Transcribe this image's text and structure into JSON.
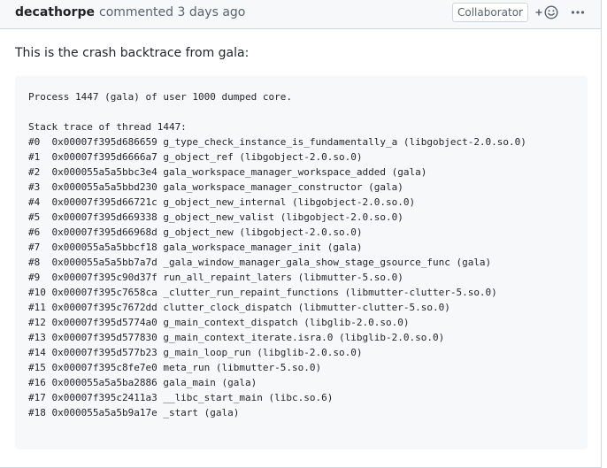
{
  "comment": {
    "author": "decathorpe",
    "action": "commented 3 days ago",
    "role_badge": "Collaborator",
    "reaction_icon": "smiley-add-icon",
    "more_icon": "kebab-horizontal-icon",
    "intro_text": "This is the crash backtrace from gala:",
    "code_lines": [
      "Process 1447 (gala) of user 1000 dumped core.",
      "",
      "Stack trace of thread 1447:",
      "#0  0x00007f395d686659 g_type_check_instance_is_fundamentally_a (libgobject-2.0.so.0)",
      "#1  0x00007f395d6666a7 g_object_ref (libgobject-2.0.so.0)",
      "#2  0x000055a5a5bbc3e4 gala_workspace_manager_workspace_added (gala)",
      "#3  0x000055a5a5bbd230 gala_workspace_manager_constructor (gala)",
      "#4  0x00007f395d66721c g_object_new_internal (libgobject-2.0.so.0)",
      "#5  0x00007f395d669338 g_object_new_valist (libgobject-2.0.so.0)",
      "#6  0x00007f395d66968d g_object_new (libgobject-2.0.so.0)",
      "#7  0x000055a5a5bbcf18 gala_workspace_manager_init (gala)",
      "#8  0x000055a5a5bb7a7d _gala_window_manager_gala_show_stage_gsource_func (gala)",
      "#9  0x00007f395c90d37f run_all_repaint_laters (libmutter-5.so.0)",
      "#10 0x00007f395c7658ca _clutter_run_repaint_functions (libmutter-clutter-5.so.0)",
      "#11 0x00007f395c7672dd clutter_clock_dispatch (libmutter-clutter-5.so.0)",
      "#12 0x00007f395d5774a0 g_main_context_dispatch (libglib-2.0.so.0)",
      "#13 0x00007f395d577830 g_main_context_iterate.isra.0 (libglib-2.0.so.0)",
      "#14 0x00007f395d577b23 g_main_loop_run (libglib-2.0.so.0)",
      "#15 0x00007f395c8fe7e0 meta_run (libmutter-5.so.0)",
      "#16 0x000055a5a5ba2886 gala_main (gala)",
      "#17 0x00007f395c2411a3 __libc_start_main (libc.so.6)",
      "#18 0x000055a5a5b9a17e _start (gala)"
    ]
  },
  "colors": {
    "header_bg": "#f6f8fa",
    "border": "#d0d7de",
    "text": "#1f2328",
    "muted": "#59636e",
    "code_bg": "#f6f8fa"
  }
}
